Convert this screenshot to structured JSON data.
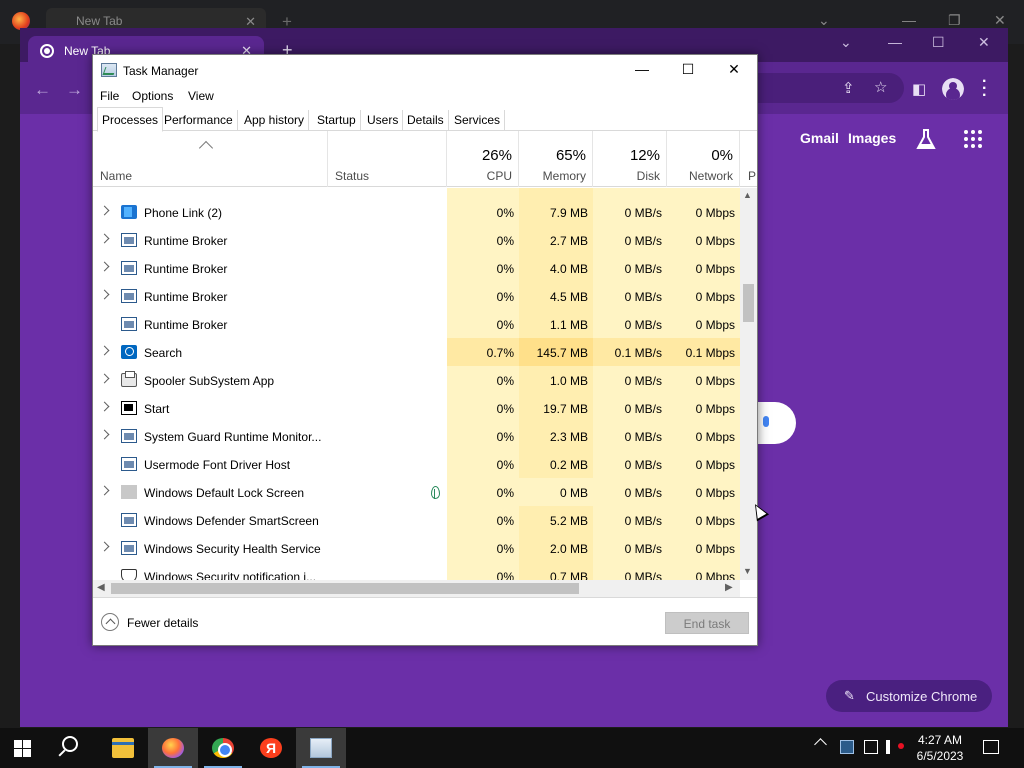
{
  "background_window": {
    "tab_title": "New Tab",
    "close_glyph": "✕",
    "new_tab_glyph": "+",
    "minimize_glyph": "—",
    "restore_glyph": "❐",
    "close_window_glyph": "✕",
    "dropdown_glyph": "⌄"
  },
  "chrome": {
    "tab_title": "New Tab",
    "close_glyph": "✕",
    "new_tab_glyph": "+",
    "dropdown_glyph": "⌄",
    "minimize_glyph": "—",
    "maximize_glyph": "☐",
    "close_window_glyph": "✕",
    "back_glyph": "←",
    "forward_glyph": "→",
    "share_glyph": "⇪",
    "star_glyph": "☆",
    "sidepanel_glyph": "◧",
    "gmail_link": "Gmail",
    "images_link": "Images",
    "customize_label": "Customize Chrome",
    "pen_glyph": "✎",
    "accent_color": "#6b2fa8"
  },
  "task_manager": {
    "title": "Task Manager",
    "minimize_glyph": "—",
    "maximize_glyph": "☐",
    "close_glyph": "✕",
    "menu": [
      "File",
      "Options",
      "View"
    ],
    "tabs": [
      "Processes",
      "Performance",
      "App history",
      "Startup",
      "Users",
      "Details",
      "Services"
    ],
    "active_tab": "Processes",
    "columns": {
      "name": "Name",
      "status": "Status",
      "cpu": {
        "label": "CPU",
        "usage": "26%"
      },
      "memory": {
        "label": "Memory",
        "usage": "65%"
      },
      "disk": {
        "label": "Disk",
        "usage": "12%"
      },
      "network": {
        "label": "Network",
        "usage": "0%"
      },
      "power_partial": "P"
    },
    "processes": [
      {
        "name": "Phone Link (2)",
        "icon": "phone-link-icon",
        "expandable": true,
        "cpu": "0%",
        "memory": "7.9 MB",
        "disk": "0 MB/s",
        "network": "0 Mbps"
      },
      {
        "name": "Runtime Broker",
        "icon": "window-app-icon",
        "expandable": true,
        "cpu": "0%",
        "memory": "2.7 MB",
        "disk": "0 MB/s",
        "network": "0 Mbps"
      },
      {
        "name": "Runtime Broker",
        "icon": "window-app-icon",
        "expandable": true,
        "cpu": "0%",
        "memory": "4.0 MB",
        "disk": "0 MB/s",
        "network": "0 Mbps"
      },
      {
        "name": "Runtime Broker",
        "icon": "window-app-icon",
        "expandable": true,
        "cpu": "0%",
        "memory": "4.5 MB",
        "disk": "0 MB/s",
        "network": "0 Mbps"
      },
      {
        "name": "Runtime Broker",
        "icon": "window-app-icon",
        "expandable": false,
        "cpu": "0%",
        "memory": "1.1 MB",
        "disk": "0 MB/s",
        "network": "0 Mbps"
      },
      {
        "name": "Search",
        "icon": "search-app-icon",
        "expandable": true,
        "cpu": "0.7%",
        "memory": "145.7 MB",
        "disk": "0.1 MB/s",
        "network": "0.1 Mbps",
        "hot": true
      },
      {
        "name": "Spooler SubSystem App",
        "icon": "printer-icon",
        "expandable": true,
        "cpu": "0%",
        "memory": "1.0 MB",
        "disk": "0 MB/s",
        "network": "0 Mbps"
      },
      {
        "name": "Start",
        "icon": "start-app-icon",
        "expandable": true,
        "cpu": "0%",
        "memory": "19.7 MB",
        "disk": "0 MB/s",
        "network": "0 Mbps"
      },
      {
        "name": "System Guard Runtime Monitor...",
        "icon": "window-app-icon",
        "expandable": true,
        "cpu": "0%",
        "memory": "2.3 MB",
        "disk": "0 MB/s",
        "network": "0 Mbps"
      },
      {
        "name": "Usermode Font Driver Host",
        "icon": "window-app-icon",
        "expandable": false,
        "cpu": "0%",
        "memory": "0.2 MB",
        "disk": "0 MB/s",
        "network": "0 Mbps"
      },
      {
        "name": "Windows Default Lock Screen",
        "icon": "lock-screen-icon",
        "expandable": true,
        "cpu": "0%",
        "memory": "0 MB",
        "disk": "0 MB/s",
        "network": "0 Mbps",
        "suspended": true
      },
      {
        "name": "Windows Defender SmartScreen",
        "icon": "window-app-icon",
        "expandable": false,
        "cpu": "0%",
        "memory": "5.2 MB",
        "disk": "0 MB/s",
        "network": "0 Mbps"
      },
      {
        "name": "Windows Security Health Service",
        "icon": "window-app-icon",
        "expandable": true,
        "cpu": "0%",
        "memory": "2.0 MB",
        "disk": "0 MB/s",
        "network": "0 Mbps"
      },
      {
        "name": "Windows Security notification i...",
        "icon": "shield-icon",
        "expandable": false,
        "cpu": "0%",
        "memory": "0.7 MB",
        "disk": "0 MB/s",
        "network": "0 Mbps"
      }
    ],
    "fewer_details_label": "Fewer details",
    "end_task_label": "End task",
    "scroll_up_glyph": "▲",
    "scroll_down_glyph": "▼",
    "scroll_left_glyph": "◀",
    "scroll_right_glyph": "▶"
  },
  "taskbar": {
    "apps": [
      "File Explorer",
      "Firefox",
      "Google Chrome",
      "Yandex Browser",
      "Task Manager"
    ],
    "yandex_letter": "Я",
    "time": "4:27 AM",
    "date": "6/5/2023"
  }
}
